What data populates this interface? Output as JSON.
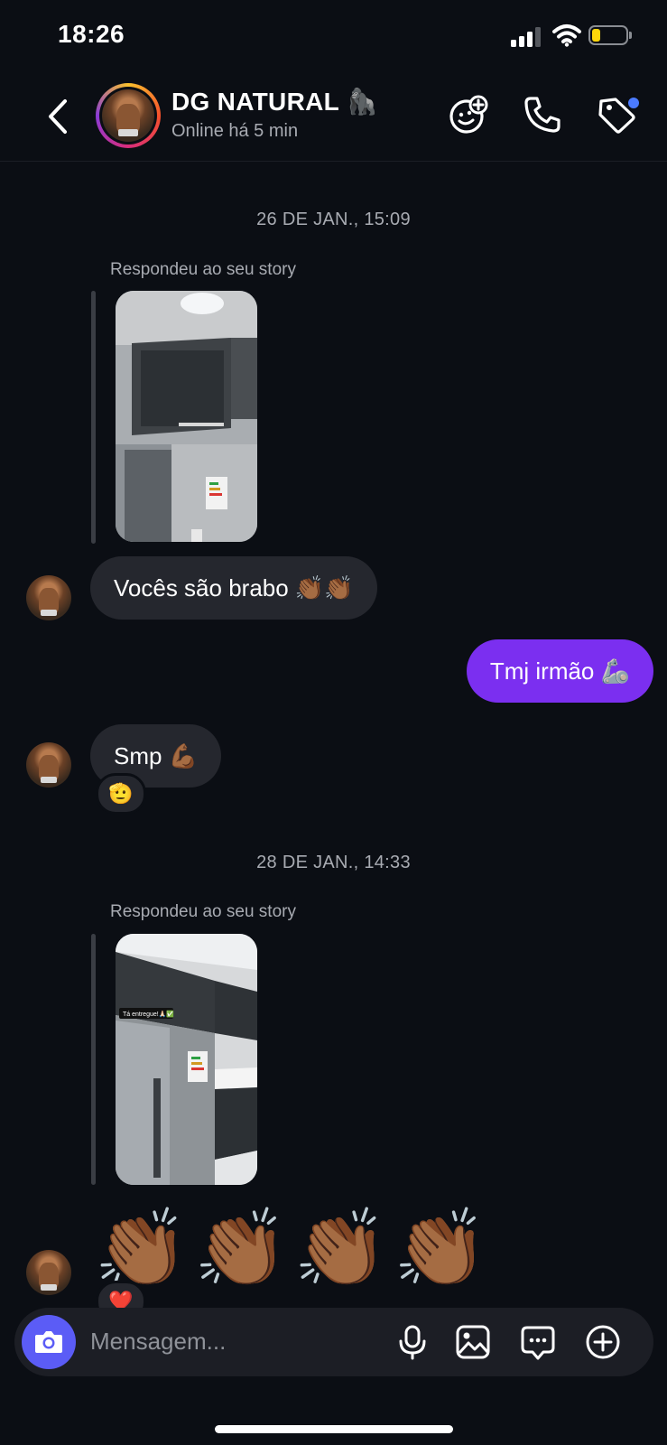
{
  "status_bar": {
    "time": "18:26"
  },
  "header": {
    "contact_name": "DG NATURAL 🦍",
    "contact_status": "Online há 5 min",
    "icons": [
      "chevron-left-icon",
      "add-emoji-icon",
      "phone-icon",
      "tag-icon"
    ]
  },
  "messages": [
    {
      "type": "date",
      "text": "26 DE JAN., 15:09"
    },
    {
      "type": "story_reply",
      "label": "Respondeu ao seu story"
    },
    {
      "type": "incoming",
      "text": "Vocês são brabo 👏🏾👏🏾"
    },
    {
      "type": "outgoing",
      "text": "Tmj irmão 🦾"
    },
    {
      "type": "incoming",
      "text": "Smp 💪🏾",
      "reaction": "🫡"
    },
    {
      "type": "date",
      "text": "28 DE JAN., 14:33"
    },
    {
      "type": "story_reply",
      "label": "Respondeu ao seu story",
      "story_text": "Tá entregue!🙏🏻✅"
    },
    {
      "type": "incoming_emoji",
      "text": "👏🏾👏🏾👏🏾👏🏾",
      "reaction": "❤️"
    }
  ],
  "composer": {
    "placeholder": "Mensagem..."
  },
  "colors": {
    "outgoing_bubble": "#7b2ff0",
    "incoming_bubble": "#25272e",
    "camera_button": "#5b5cf6",
    "background": "#0b0e14"
  }
}
